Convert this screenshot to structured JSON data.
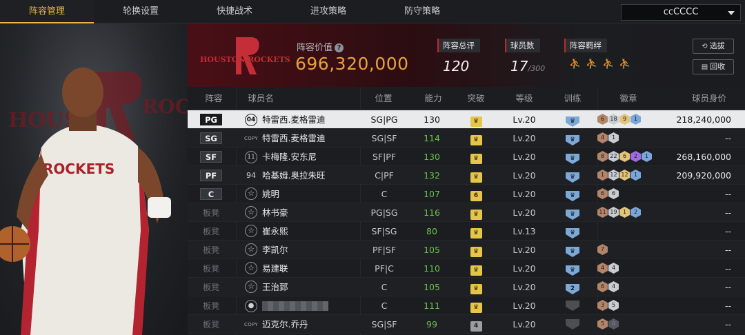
{
  "nav": {
    "tabs": [
      "阵容管理",
      "轮换设置",
      "快捷战术",
      "进攻策略",
      "防守策略"
    ],
    "active_index": 0,
    "user": "ccCCCC"
  },
  "team": {
    "logo_text": "HOUSTON ROCKETS",
    "value_label": "阵容价值",
    "value": "696,320,000",
    "overall_label": "阵容总评",
    "overall": "120",
    "players_label": "球员数",
    "players": "17",
    "players_max": "/300",
    "bonds_label": "阵容羁绊",
    "select_button": "选拔",
    "recycle_button": "回收"
  },
  "portrait": {
    "bg_text": "HOUSTON ROCKETS"
  },
  "columns": {
    "pos": "阵容",
    "name": "球员名",
    "position": "位置",
    "rating": "能力",
    "break": "突破",
    "level": "等级",
    "train": "训练",
    "badges": "徽章",
    "worth": "球员身价"
  },
  "rows": [
    {
      "pos": "PG",
      "bench": false,
      "num": "04",
      "numtype": "num",
      "name": "特雷西.麦格雷迪",
      "position": "SG|PG",
      "rating": "130",
      "break": "♛",
      "break_gray": false,
      "level": "Lv.20",
      "train": "♛",
      "badges": [
        [
          "h-bronze",
          "6"
        ],
        [
          "h-silver",
          "18"
        ],
        [
          "h-gold",
          "9"
        ],
        [
          "h-blue",
          "1"
        ]
      ],
      "worth": "218,240,000"
    },
    {
      "pos": "SG",
      "bench": false,
      "num": "COPY",
      "numtype": "copy",
      "name": "特雷西.麦格雷迪",
      "position": "SG|SF",
      "rating": "114",
      "break": "♛",
      "break_gray": false,
      "level": "Lv.20",
      "train": "♛",
      "badges": [
        [
          "h-bronze",
          "4"
        ],
        [
          "h-silver",
          "1"
        ]
      ],
      "worth": "--"
    },
    {
      "pos": "SF",
      "bench": false,
      "num": "11",
      "numtype": "num",
      "name": "卡梅隆.安东尼",
      "position": "SF|PF",
      "rating": "130",
      "break": "♛",
      "break_gray": false,
      "level": "Lv.20",
      "train": "♛",
      "badges": [
        [
          "h-bronze",
          "8"
        ],
        [
          "h-silver",
          "22"
        ],
        [
          "h-gold",
          "6"
        ],
        [
          "h-purple",
          "2"
        ],
        [
          "h-blue",
          "1"
        ]
      ],
      "worth": "268,160,000"
    },
    {
      "pos": "PF",
      "bench": false,
      "num": "94",
      "numtype": "plain",
      "name": "哈基姆.奥拉朱旺",
      "position": "C|PF",
      "rating": "132",
      "break": "♛",
      "break_gray": false,
      "level": "Lv.20",
      "train": "♛",
      "badges": [
        [
          "h-bronze",
          "1"
        ],
        [
          "h-silver",
          "12"
        ],
        [
          "h-gold",
          "12"
        ],
        [
          "h-blue",
          "1"
        ]
      ],
      "worth": "209,920,000"
    },
    {
      "pos": "C",
      "bench": false,
      "num": "☆",
      "numtype": "star",
      "name": "姚明",
      "position": "C",
      "rating": "107",
      "break": "6",
      "break_gray": false,
      "level": "Lv.20",
      "train": "♛",
      "badges": [
        [
          "h-bronze",
          "6"
        ],
        [
          "h-silver",
          "6"
        ]
      ],
      "worth": "--"
    },
    {
      "pos": "板凳",
      "bench": true,
      "num": "☆",
      "numtype": "star",
      "name": "林书豪",
      "position": "PG|SG",
      "rating": "116",
      "break": "♛",
      "break_gray": false,
      "level": "Lv.20",
      "train": "♛",
      "badges": [
        [
          "h-bronze",
          "11"
        ],
        [
          "h-silver",
          "19"
        ],
        [
          "h-gold",
          "1"
        ],
        [
          "h-blue",
          "2"
        ]
      ],
      "worth": "--"
    },
    {
      "pos": "板凳",
      "bench": true,
      "num": "☆",
      "numtype": "star",
      "name": "崔永熙",
      "position": "SF|SG",
      "rating": "80",
      "break": "♛",
      "break_gray": false,
      "level": "Lv.13",
      "train": "♛",
      "badges": [],
      "worth": "--"
    },
    {
      "pos": "板凳",
      "bench": true,
      "num": "☆",
      "numtype": "star",
      "name": "李凯尔",
      "position": "PF|SF",
      "rating": "105",
      "break": "♛",
      "break_gray": false,
      "level": "Lv.20",
      "train": "♛",
      "badges": [
        [
          "h-bronze",
          "7"
        ]
      ],
      "worth": "--"
    },
    {
      "pos": "板凳",
      "bench": true,
      "num": "☆",
      "numtype": "star",
      "name": "易建联",
      "position": "PF|C",
      "rating": "110",
      "break": "♛",
      "break_gray": false,
      "level": "Lv.20",
      "train": "♛",
      "badges": [
        [
          "h-bronze",
          "4"
        ],
        [
          "h-silver",
          "4"
        ]
      ],
      "worth": "--"
    },
    {
      "pos": "板凳",
      "bench": true,
      "num": "☆",
      "numtype": "star",
      "name": "王治郅",
      "position": "C",
      "rating": "105",
      "break": "♛",
      "break_gray": false,
      "level": "Lv.20",
      "train": "2",
      "badges": [
        [
          "h-bronze",
          "6"
        ],
        [
          "h-silver",
          "4"
        ]
      ],
      "worth": "--"
    },
    {
      "pos": "板凳",
      "bench": true,
      "num": "👤",
      "numtype": "avatar",
      "name": "",
      "position": "C",
      "rating": "111",
      "break": "♛",
      "break_gray": false,
      "level": "Lv.20",
      "train": "",
      "badges": [
        [
          "h-bronze",
          "3"
        ],
        [
          "h-silver",
          "5"
        ]
      ],
      "worth": "--"
    },
    {
      "pos": "板凳",
      "bench": true,
      "num": "COPY",
      "numtype": "copy",
      "name": "迈克尔.乔丹",
      "position": "SG|SF",
      "rating": "99",
      "break": "4",
      "break_gray": true,
      "level": "Lv.20",
      "train": "",
      "badges": [
        [
          "h-bronze",
          "5"
        ],
        [
          "h-dark",
          "0"
        ]
      ],
      "worth": "--"
    }
  ]
}
